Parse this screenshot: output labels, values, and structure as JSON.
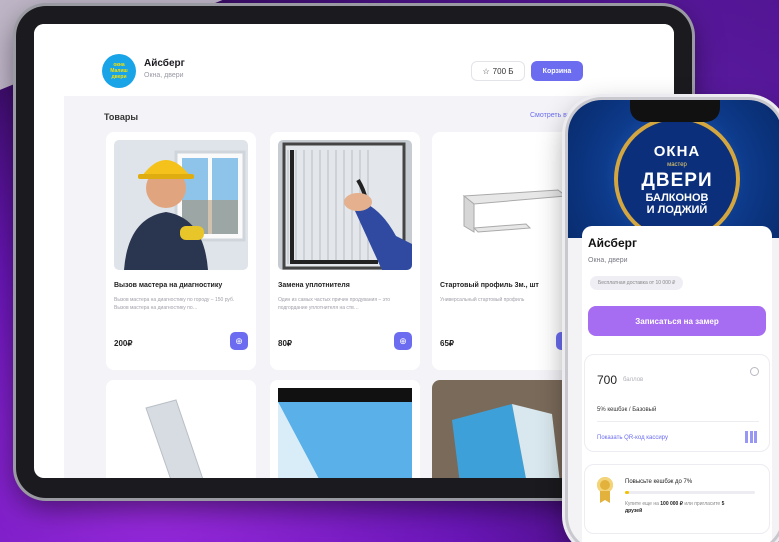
{
  "app": {
    "logo_text": "окна Малиш двери",
    "shop_name": "Айсберг",
    "shop_subtitle": "Окна, двери",
    "points_label": "700 Б",
    "cart_label": "Корзина"
  },
  "catalog": {
    "title": "Товары",
    "see_all": "Смотреть все",
    "products": [
      {
        "title": "Вызов мастера на диагностику",
        "desc": "Вызов мастера на диагностику по городу – 150 руб. Вызов мастера на диагностику по…",
        "price": "200₽"
      },
      {
        "title": "Замена уплотнителя",
        "desc": "Один из самых частых причин продувания – это подгордание уплотнителя на ств…",
        "price": "80₽"
      },
      {
        "title": "Стартовый профиль 3м., шт",
        "desc": "Универсальный стартовый профиль",
        "price": "65₽"
      }
    ]
  },
  "phone": {
    "banner": {
      "word1": "ОКНА",
      "word2": "мастер",
      "word3": "ДВЕРИ",
      "word4": "БАЛКОНОВ",
      "word5": "И ЛОДЖИЙ"
    },
    "shop_name": "Айсберг",
    "shop_subtitle": "Окна, двери",
    "delivery_chip": "Бесплатная доставка от 10 000 ₽",
    "cta_label": "Записаться на замер",
    "points_value": "700",
    "points_unit": "баллов",
    "cashback_line": "5% кешбэк / Базовый",
    "qr_link": "Показать QR-код кассиру",
    "upgrade_title": "Повысьте кешбэк до 7%",
    "upgrade_progress": 0.03,
    "upgrade_hint_prefix": "Купите еще на",
    "upgrade_hint_amount": "100 000 ₽",
    "upgrade_hint_mid": "или пригласите",
    "upgrade_hint_friends": "5 друзей"
  },
  "colors": {
    "accent": "#6b6cf0",
    "cta": "#a66cf1",
    "logo_bg": "#1aa4e8",
    "medal": "#e3b23c"
  }
}
